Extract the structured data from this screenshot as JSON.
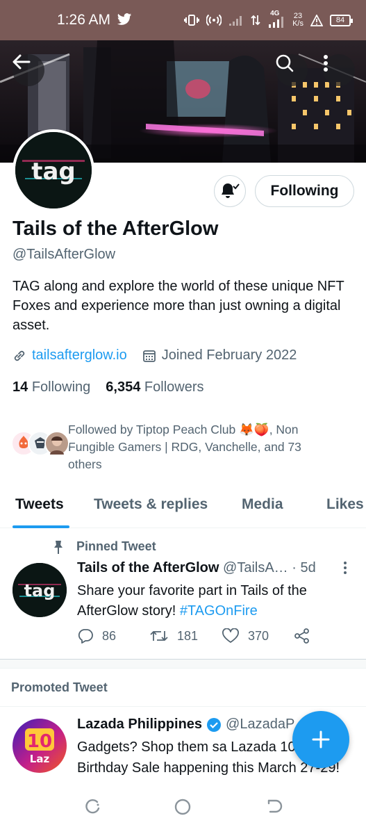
{
  "status_bar": {
    "time": "1:26 AM",
    "network_type": "4G",
    "speed_value": "23",
    "speed_unit": "K/s",
    "battery": "84",
    "icons": [
      "twitter-bird-icon",
      "vibrate-icon",
      "hotspot-icon",
      "signal-icon",
      "data-arrows-icon",
      "signal-4g-icon",
      "alert-triangle-icon",
      "battery-icon"
    ]
  },
  "header": {
    "back_icon": "arrow-left-icon",
    "search_icon": "search-icon",
    "more_icon": "more-vertical-icon"
  },
  "profile": {
    "avatar_text": "tag",
    "name": "Tails of the AfterGlow",
    "handle": "@TailsAfterGlow",
    "bio": "TAG along and explore the world of these unique NFT Foxes and experience more than just owning a digital asset.",
    "website": "tailsafterglow.io",
    "joined": "Joined February 2022",
    "following_count": "14",
    "following_label": "Following",
    "followers_count": "6,354",
    "followers_label": "Followers",
    "follow_button": "Following",
    "notify_icon": "bell-check-icon",
    "followed_by": "Followed by Tiptop Peach Club 🦊🍑, Non Fungible Gamers | RDG, Vanchelle, and 73 others"
  },
  "tabs": [
    {
      "label": "Tweets",
      "active": true
    },
    {
      "label": "Tweets & replies",
      "active": false
    },
    {
      "label": "Media",
      "active": false
    },
    {
      "label": "Likes",
      "active": false
    }
  ],
  "pinned_tweet": {
    "pinned_label": "Pinned Tweet",
    "author": "Tails of the AfterGlow",
    "handle_time": "@TailsA… · 5d",
    "text_main": "Share your favorite part in Tails of the AfterGlow story! ",
    "hashtag": "#TAGOnFire",
    "replies": "86",
    "retweets": "181",
    "likes": "370"
  },
  "promoted": {
    "label": "Promoted Tweet",
    "author": "Lazada Philippines",
    "handle": "@LazadaP…",
    "avatar_number": "10",
    "avatar_brand": "Laz",
    "text": "Gadgets? Shop them sa Lazada 10.10 Epic Birthday Sale happening this March 27-29!"
  },
  "colors": {
    "accent": "#1d9bf0",
    "status_bar": "#7a5a57",
    "secondary_text": "#536471"
  }
}
